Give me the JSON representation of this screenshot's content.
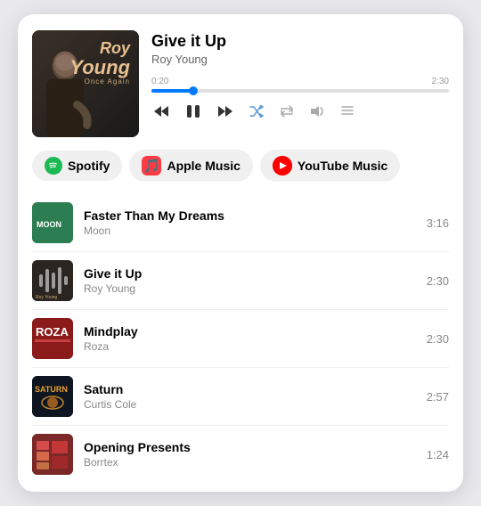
{
  "card": {
    "now_playing": {
      "title": "Give it Up",
      "artist": "Roy Young",
      "album": "Once Again",
      "current_time": "0:20",
      "total_time": "2:30",
      "progress_percent": 14
    },
    "controls": {
      "rewind": "⏮",
      "play_pause": "⏸",
      "fast_forward": "⏭",
      "shuffle": "shuffle",
      "repeat": "repeat",
      "volume": "volume",
      "queue": "queue"
    },
    "service_tabs": [
      {
        "id": "spotify",
        "label": "Spotify",
        "active": false
      },
      {
        "id": "apple",
        "label": "Apple Music",
        "active": false
      },
      {
        "id": "youtube",
        "label": "YouTube Music",
        "active": false
      }
    ],
    "tracks": [
      {
        "title": "Faster Than My Dreams",
        "artist": "Moon",
        "duration": "3:16",
        "thumb_class": "thumb-faster"
      },
      {
        "title": "Give it Up",
        "artist": "Roy Young",
        "duration": "2:30",
        "thumb_class": "thumb-giveitup"
      },
      {
        "title": "Mindplay",
        "artist": "Roza",
        "duration": "2:30",
        "thumb_class": "thumb-mindplay"
      },
      {
        "title": "Saturn",
        "artist": "Curtis Cole",
        "duration": "2:57",
        "thumb_class": "thumb-saturn"
      },
      {
        "title": "Opening Presents",
        "artist": "Borrtex",
        "duration": "1:24",
        "thumb_class": "thumb-opening"
      }
    ]
  }
}
